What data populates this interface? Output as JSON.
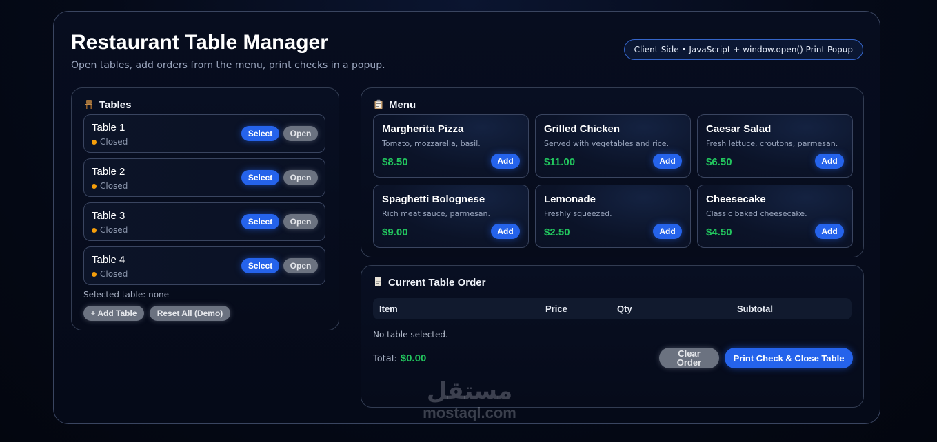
{
  "header": {
    "title": "Restaurant Table Manager",
    "subtitle": "Open tables, add orders from the menu, print checks in a popup.",
    "tech_badge": "Client-Side • JavaScript + window.open() Print Popup"
  },
  "tables_panel": {
    "icon": "chair-icon",
    "title": "Tables",
    "select_label": "Select",
    "open_label": "Open",
    "status_color": "#f59e0b",
    "tables": [
      {
        "name": "Table 1",
        "status": "Closed"
      },
      {
        "name": "Table 2",
        "status": "Closed"
      },
      {
        "name": "Table 3",
        "status": "Closed"
      },
      {
        "name": "Table 4",
        "status": "Closed"
      }
    ],
    "selected_text": "Selected table: none",
    "add_table_label": "+ Add Table",
    "reset_label": "Reset All (Demo)"
  },
  "menu_panel": {
    "icon": "clipboard-icon",
    "title": "Menu",
    "add_label": "Add",
    "price_color": "#22c55e",
    "items": [
      {
        "name": "Margherita Pizza",
        "desc": "Tomato, mozzarella, basil.",
        "price": "$8.50"
      },
      {
        "name": "Grilled Chicken",
        "desc": "Served with vegetables and rice.",
        "price": "$11.00"
      },
      {
        "name": "Caesar Salad",
        "desc": "Fresh lettuce, croutons, parmesan.",
        "price": "$6.50"
      },
      {
        "name": "Spaghetti Bolognese",
        "desc": "Rich meat sauce, parmesan.",
        "price": "$9.00"
      },
      {
        "name": "Lemonade",
        "desc": "Freshly squeezed.",
        "price": "$2.50"
      },
      {
        "name": "Cheesecake",
        "desc": "Classic baked cheesecake.",
        "price": "$4.50"
      }
    ]
  },
  "order_panel": {
    "icon": "receipt-icon",
    "title": "Current Table Order",
    "columns": [
      "Item",
      "Price",
      "Qty",
      "Subtotal"
    ],
    "empty_text": "No table selected.",
    "total_label": "Total:",
    "total_value": "$0.00",
    "clear_label": "Clear Order",
    "print_label": "Print Check & Close Table"
  },
  "watermark": {
    "arabic": "مستقل",
    "latin": "mostaql.com"
  },
  "colors": {
    "accent": "#2563eb",
    "gray_button": "#6b7280",
    "price_green": "#22c55e",
    "closed_status": "#f59e0b"
  }
}
